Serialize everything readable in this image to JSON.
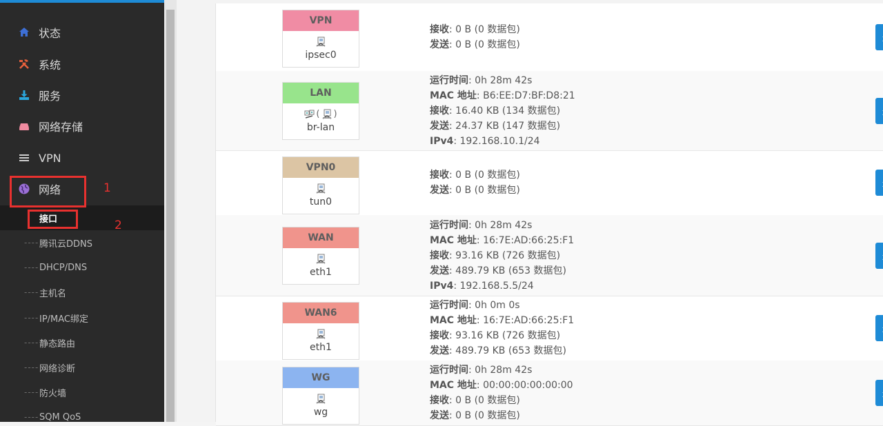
{
  "sidebar": {
    "menu": [
      {
        "label": "状态",
        "icon": "home-icon",
        "color": "#3d6fd6"
      },
      {
        "label": "系统",
        "icon": "tools-icon",
        "color": "#e8603c"
      },
      {
        "label": "服务",
        "icon": "download-icon",
        "color": "#2aa6dc"
      },
      {
        "label": "网络存储",
        "icon": "drive-icon",
        "color": "#f08ba0"
      },
      {
        "label": "VPN",
        "icon": "list-icon",
        "color": "#cfcfcf"
      },
      {
        "label": "网络",
        "icon": "globe-icon",
        "color": "#9b6fd6"
      }
    ],
    "submenu": [
      {
        "label": "接口",
        "active": true
      },
      {
        "label": "腾讯云DDNS"
      },
      {
        "label": "DHCP/DNS"
      },
      {
        "label": "主机名"
      },
      {
        "label": "IP/MAC绑定"
      },
      {
        "label": "静态路由"
      },
      {
        "label": "网络诊断"
      },
      {
        "label": "防火墙"
      },
      {
        "label": "SQM QoS"
      }
    ],
    "sub_dash": "----",
    "annotations": {
      "one": "1",
      "two": "2"
    }
  },
  "labels": {
    "uptime": "运行时间",
    "mac": "MAC 地址",
    "rx": "接收",
    "tx": "发送",
    "ipv4": "IPv4",
    "sep": ": "
  },
  "interfaces": [
    {
      "name": "VPN",
      "color": "#f08ca4",
      "device": "ipsec0",
      "icons": "single",
      "rx": "0 B (0 数据包)",
      "tx": "0 B (0 数据包)"
    },
    {
      "name": "LAN",
      "color": "#98e48c",
      "device": "br-lan",
      "icons": "bridge",
      "uptime": "0h 28m 42s",
      "mac": "B6:EE:D7:BF:D8:21",
      "rx": "16.40 KB (134 数据包)",
      "tx": "24.37 KB (147 数据包)",
      "ipv4": "192.168.10.1/24"
    },
    {
      "name": "VPN0",
      "color": "#dcc5a4",
      "device": "tun0",
      "icons": "single",
      "rx": "0 B (0 数据包)",
      "tx": "0 B (0 数据包)"
    },
    {
      "name": "WAN",
      "color": "#f0948c",
      "device": "eth1",
      "icons": "single",
      "uptime": "0h 28m 42s",
      "mac": "16:7E:AD:66:25:F1",
      "rx": "93.16 KB (726 数据包)",
      "tx": "489.79 KB (653 数据包)",
      "ipv4": "192.168.5.5/24"
    },
    {
      "name": "WAN6",
      "color": "#f0948c",
      "device": "eth1",
      "icons": "single",
      "uptime": "0h 0m 0s",
      "mac": "16:7E:AD:66:25:F1",
      "rx": "93.16 KB (726 数据包)",
      "tx": "489.79 KB (653 数据包)"
    },
    {
      "name": "WG",
      "color": "#8cb4f0",
      "device": "wg",
      "icons": "single",
      "uptime": "0h 28m 42s",
      "mac": "00:00:00:00:00:00",
      "rx": "0 B (0 数据包)",
      "tx": "0 B (0 数据包)"
    }
  ],
  "edge_button_glyph": "连"
}
